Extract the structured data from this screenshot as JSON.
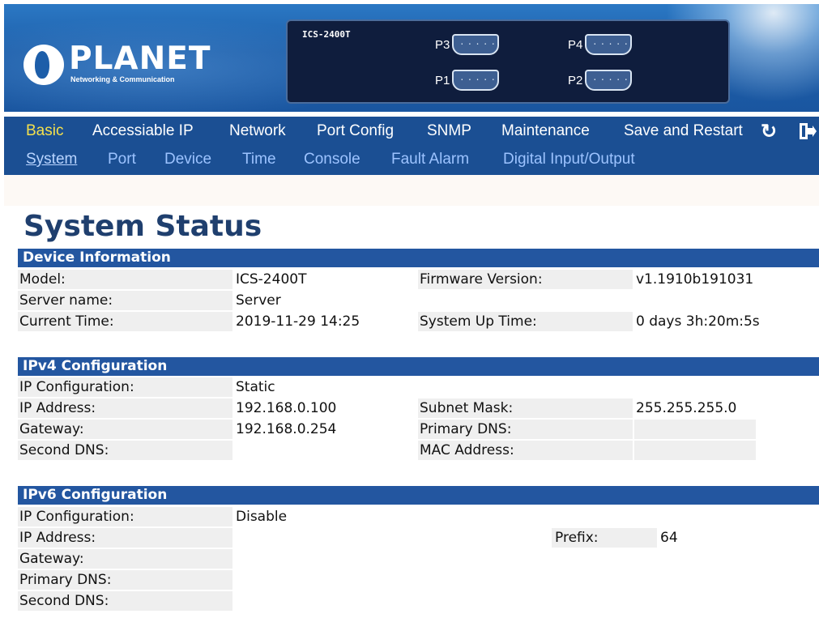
{
  "header": {
    "logo_text": "PLANET",
    "logo_subtext": "Networking & Communication",
    "device_model": "ICS-2400T",
    "ports": [
      "P3",
      "P4",
      "P1",
      "P2"
    ]
  },
  "main_menu": {
    "items": [
      "Basic",
      "Accessiable IP",
      "Network",
      "Port Config",
      "SNMP",
      "Maintenance",
      "Save and Restart"
    ],
    "active": "Basic",
    "refresh_icon": "refresh-icon",
    "logout_icon": "logout-icon"
  },
  "sub_menu": {
    "items": [
      "System",
      "Port",
      "Device",
      "Time",
      "Console",
      "Fault Alarm",
      "Digital Input/Output"
    ],
    "active": "System"
  },
  "page_title": "System Status",
  "device_info": {
    "header": "Device Information",
    "model_label": "Model:",
    "model_value": "ICS-2400T",
    "firmware_label": "Firmware Version:",
    "firmware_value": "v1.1910b191031",
    "server_name_label": "Server name:",
    "server_name_value": "Server",
    "current_time_label": "Current Time:",
    "current_time_value": "2019-11-29 14:25",
    "uptime_label": "System Up Time:",
    "uptime_value": "0 days 3h:20m:5s"
  },
  "ipv4": {
    "header": "IPv4 Configuration",
    "ip_config_label": "IP Configuration:",
    "ip_config_value": "Static",
    "ip_address_label": "IP Address:",
    "ip_address_value": "192.168.0.100",
    "subnet_label": "Subnet Mask:",
    "subnet_value": "255.255.255.0",
    "gateway_label": "Gateway:",
    "gateway_value": "192.168.0.254",
    "primary_dns_label": "Primary DNS:",
    "primary_dns_value": "",
    "second_dns_label": "Second DNS:",
    "second_dns_value": "",
    "mac_label": "MAC Address:",
    "mac_value": ""
  },
  "ipv6": {
    "header": "IPv6 Configuration",
    "ip_config_label": "IP Configuration:",
    "ip_config_value": "Disable",
    "ip_address_label": "IP Address:",
    "ip_address_value": "",
    "prefix_label": "Prefix:",
    "prefix_value": "64",
    "gateway_label": "Gateway:",
    "gateway_value": "",
    "primary_dns_label": "Primary DNS:",
    "primary_dns_value": "",
    "second_dns_label": "Second DNS:",
    "second_dns_value": ""
  }
}
